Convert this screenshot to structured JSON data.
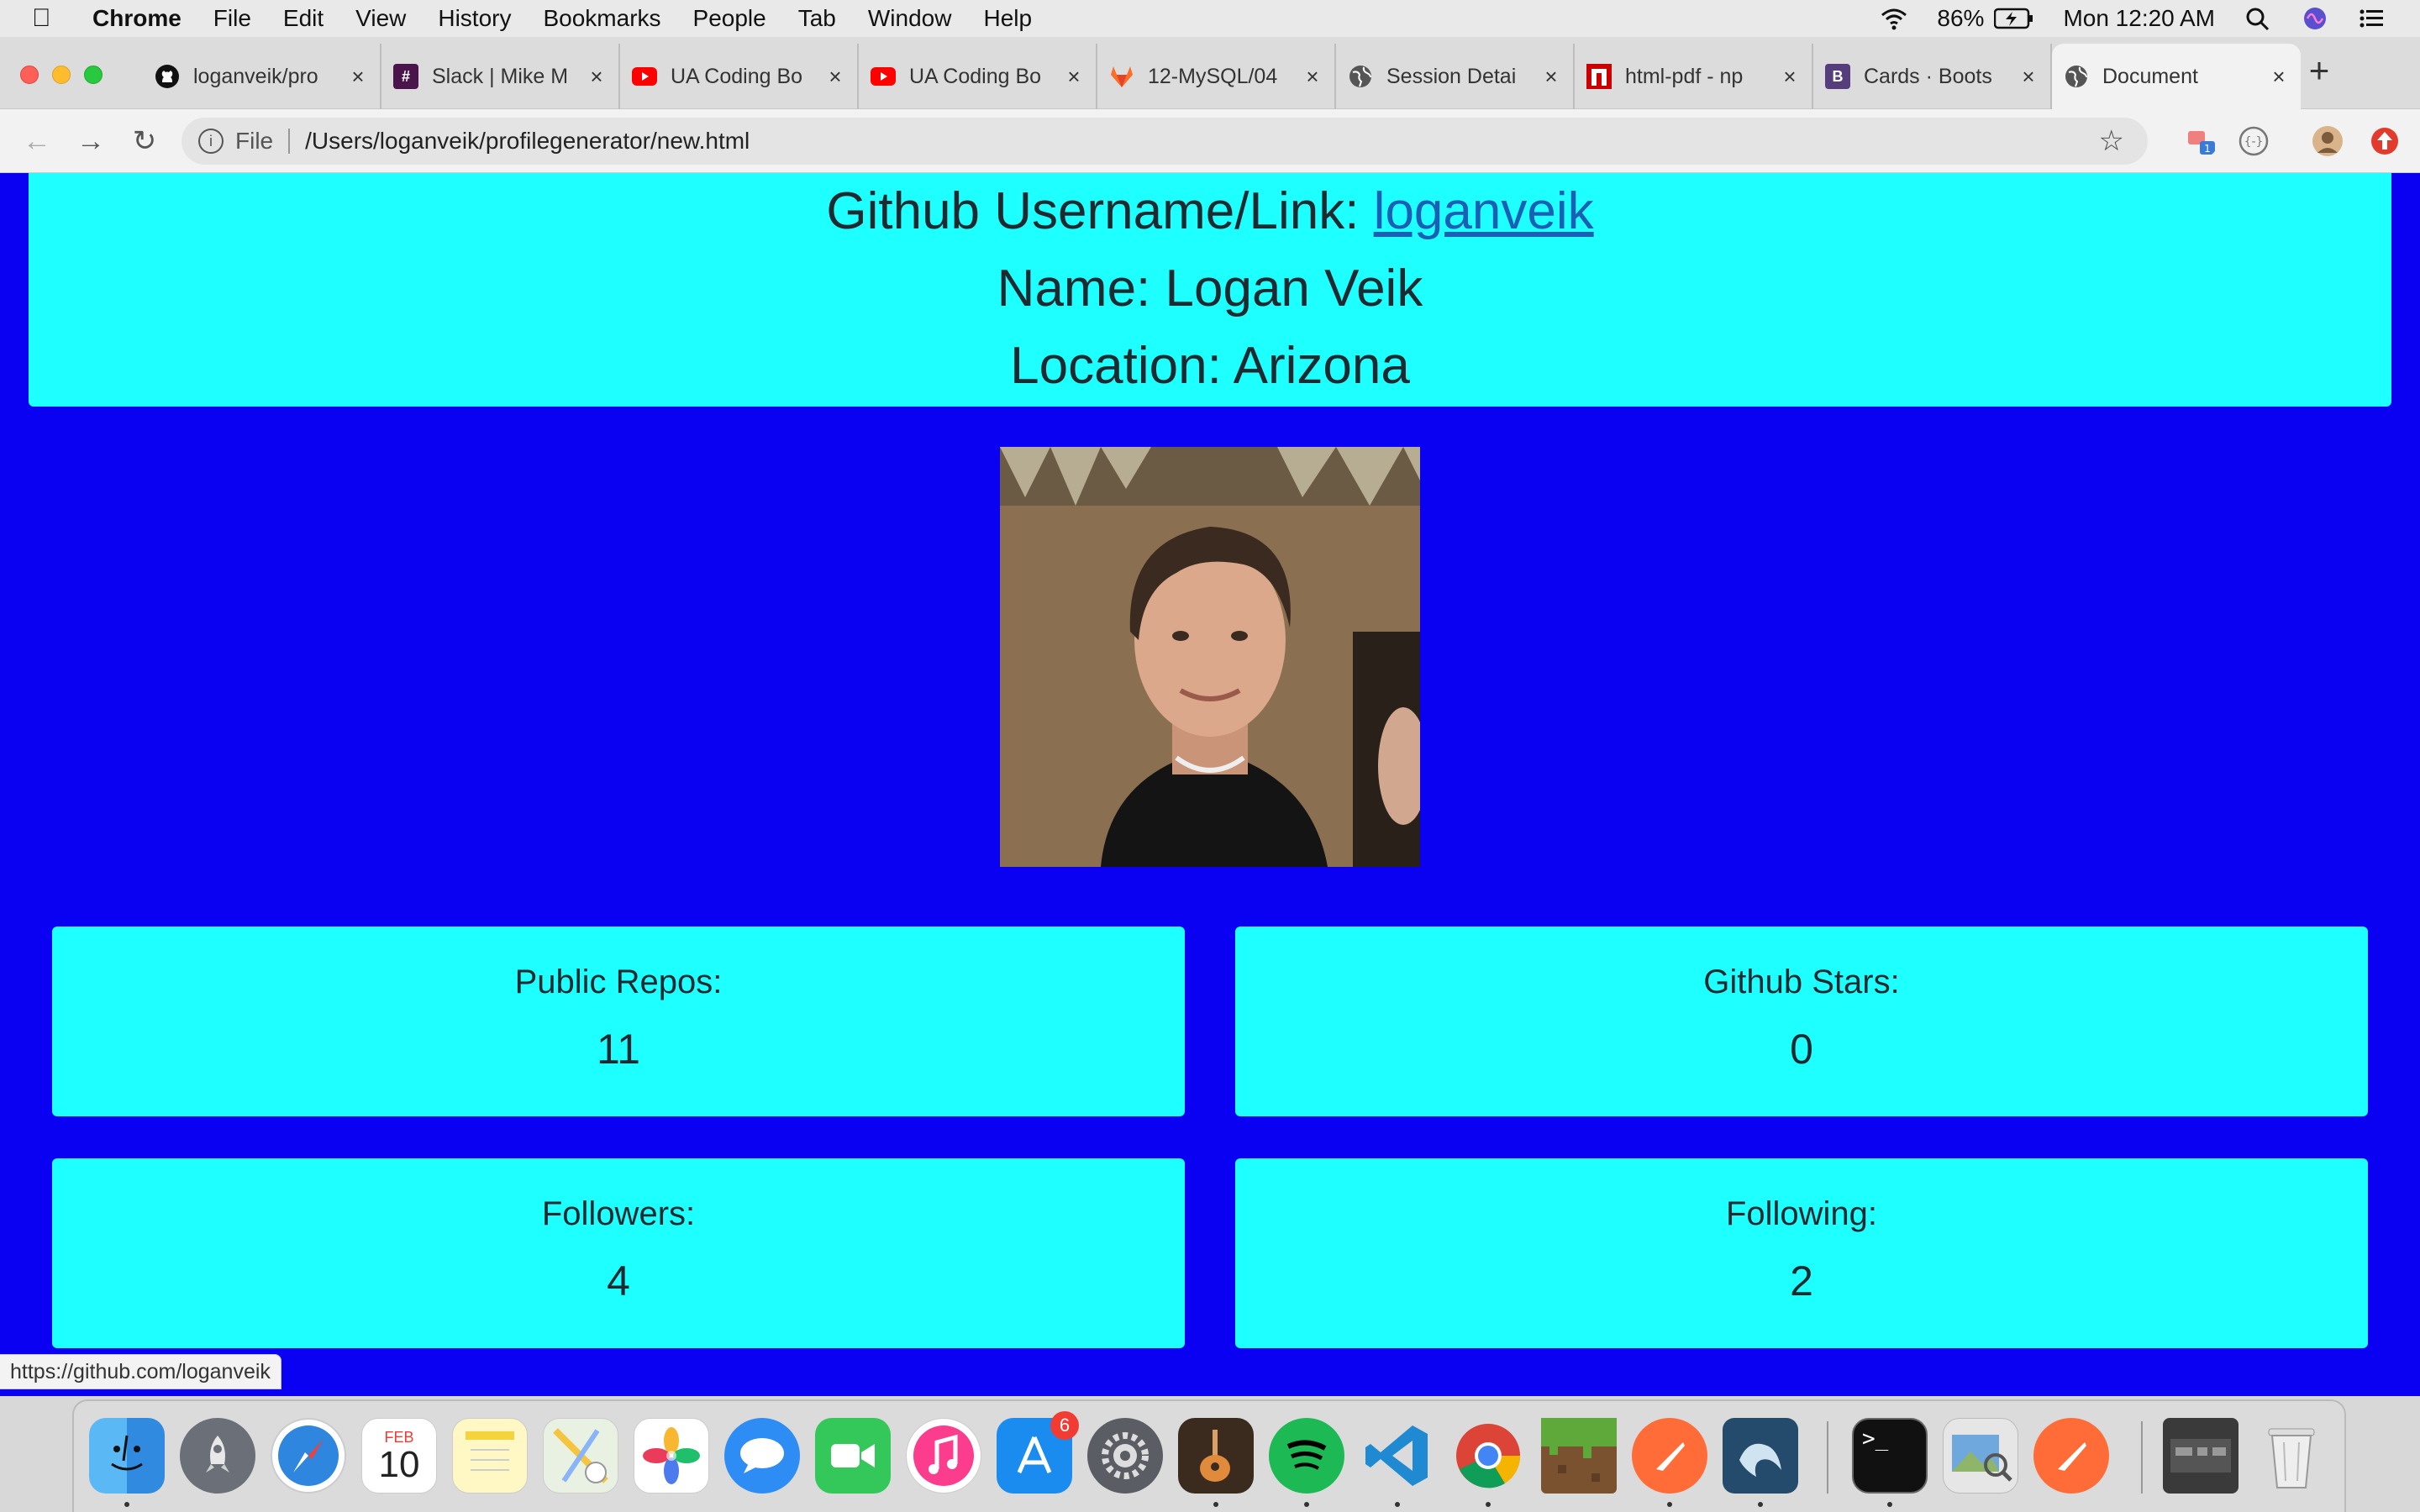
{
  "menubar": {
    "app_name": "Chrome",
    "items": [
      "File",
      "Edit",
      "View",
      "History",
      "Bookmarks",
      "People",
      "Tab",
      "Window",
      "Help"
    ],
    "battery": "86%",
    "clock": "Mon 12:20 AM"
  },
  "tabs": [
    {
      "title": "loganveik/pro",
      "favicon": "github-icon"
    },
    {
      "title": "Slack | Mike M",
      "favicon": "slack-icon"
    },
    {
      "title": "UA Coding Bo",
      "favicon": "youtube-icon"
    },
    {
      "title": "UA Coding Bo",
      "favicon": "youtube-icon"
    },
    {
      "title": "12-MySQL/04",
      "favicon": "gitlab-icon"
    },
    {
      "title": "Session Detai",
      "favicon": "globe-icon"
    },
    {
      "title": "html-pdf - np",
      "favicon": "npm-icon"
    },
    {
      "title": "Cards · Boots",
      "favicon": "bootstrap-icon"
    },
    {
      "title": "Document",
      "favicon": "globe-icon",
      "active": true
    }
  ],
  "toolbar": {
    "scheme": "File",
    "url": "/Users/loganveik/profilegenerator/new.html"
  },
  "profile": {
    "username_label": "Github Username/Link:",
    "username": "loganveik",
    "name_line": "Name: Logan Veik",
    "location_line": "Location: Arizona"
  },
  "stats": {
    "repos": {
      "label": "Public Repos:",
      "value": "11"
    },
    "stars": {
      "label": "Github Stars:",
      "value": "0"
    },
    "followers": {
      "label": "Followers:",
      "value": "4"
    },
    "following": {
      "label": "Following:",
      "value": "2"
    }
  },
  "status_url": "https://github.com/loganveik",
  "dock": {
    "calendar_month": "FEB",
    "calendar_day": "10",
    "appstore_badge": "6"
  },
  "colors": {
    "page_bg": "#0a00f2",
    "card_bg": "#1effff"
  }
}
